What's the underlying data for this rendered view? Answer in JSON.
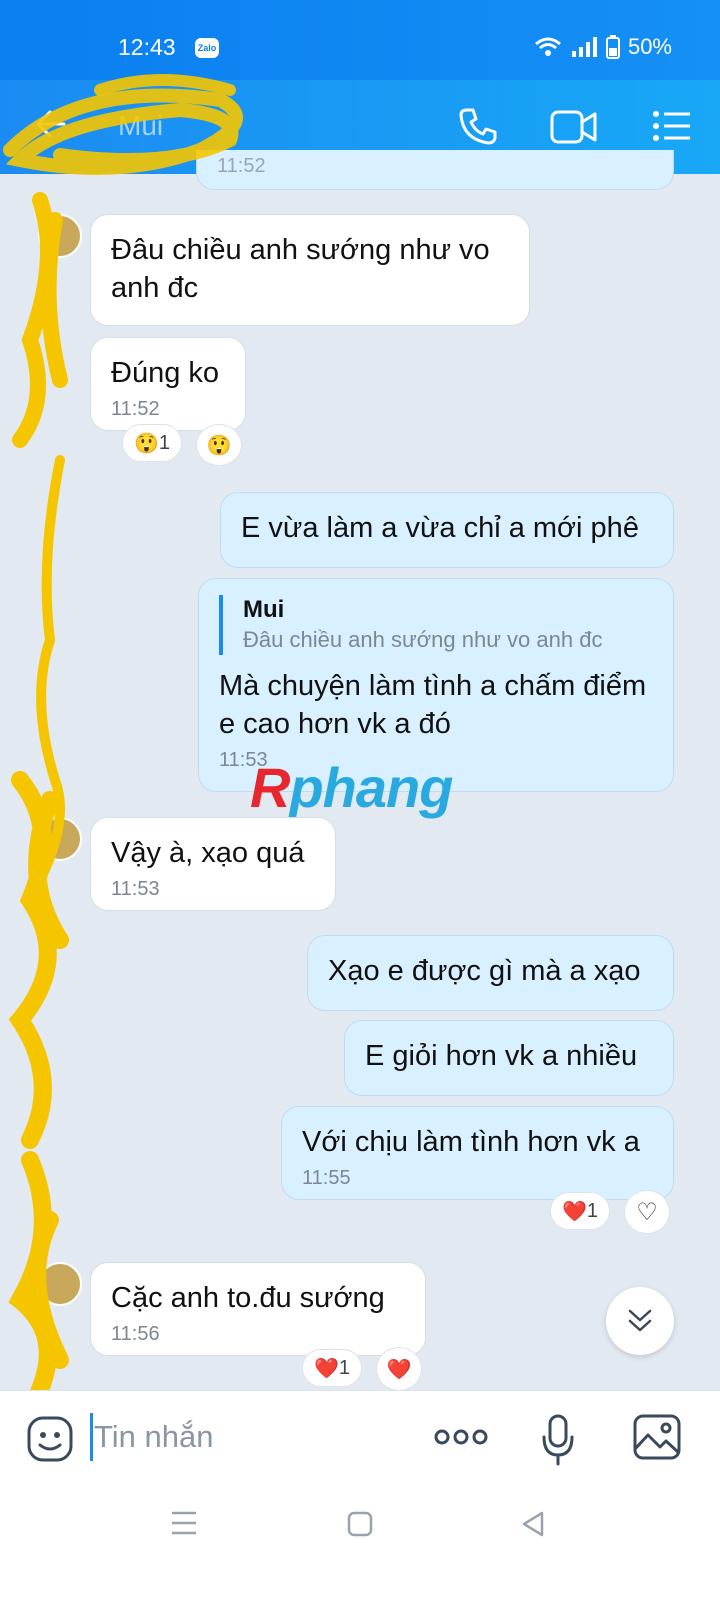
{
  "status_bar": {
    "time": "12:43",
    "app_badge": "Zalo",
    "battery": "50%"
  },
  "header": {
    "contact_name": "Mui"
  },
  "messages": [
    {
      "text": "11:52",
      "partial": true
    },
    {
      "text": "Đâu chiều anh sướng như vo anh đc"
    },
    {
      "text": "Đúng ko",
      "time": "11:52",
      "reactions": [
        {
          "emoji": "😲",
          "count": "1"
        },
        {
          "emoji": "😲"
        }
      ]
    },
    {
      "text": "E vừa làm a vừa chỉ a mới phê"
    },
    {
      "quote_name": "Mui",
      "quote_text": "Đâu chiều anh sướng như vo anh đc",
      "text": "Mà chuyện làm tình a chấm điểm e cao hơn vk a đó",
      "time": "11:53"
    },
    {
      "text": "Vậy à, xạo quá",
      "time": "11:53"
    },
    {
      "text": "Xạo e được gì mà a xạo"
    },
    {
      "text": "E giỏi hơn vk a nhiều"
    },
    {
      "text": "Với chịu làm tình hơn vk a",
      "time": "11:55",
      "reactions": [
        {
          "emoji": "❤️",
          "count": "1"
        },
        {
          "emoji": "♡"
        }
      ]
    },
    {
      "text": "Cặc anh to.đu sướng",
      "time": "11:56",
      "reactions": [
        {
          "emoji": "❤️",
          "count": "1"
        },
        {
          "emoji": "❤️"
        }
      ]
    }
  ],
  "watermark": {
    "part1": "R",
    "part2": "phang"
  },
  "composer": {
    "placeholder": "Tin nhắn",
    "more": "ooo"
  },
  "icons": [
    "back-arrow-icon",
    "phone-icon",
    "video-icon",
    "menu-icon",
    "emoji-icon",
    "microphone-icon",
    "gallery-icon",
    "chevron-double-down-icon"
  ],
  "colors": {
    "header": "#1a8bf2",
    "outgoing_bubble": "#d8f0ff",
    "background": "#e2e9f1"
  }
}
